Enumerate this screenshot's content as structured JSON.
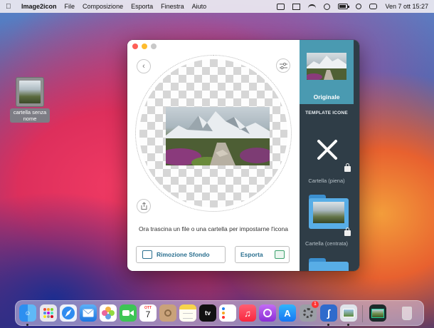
{
  "menubar": {
    "app_name": "Image2icon",
    "items": [
      "File",
      "Composizione",
      "Esporta",
      "Finestra",
      "Aiuto"
    ],
    "clock": "Ven 7 ott  15:27",
    "status_icons": [
      "screen-mirroring-icon",
      "display-icon",
      "wifi-icon",
      "user-icon",
      "battery-icon",
      "search-icon",
      "control-center-icon"
    ]
  },
  "desktop": {
    "folder_label": "cartella senza nome"
  },
  "window": {
    "instruction": "Ora trascina un file o una cartella per impostarne l'icona",
    "remove_bg_label": "Rimozione Sfondo",
    "export_label": "Esporta"
  },
  "sidebar": {
    "original_label": "Originale",
    "section_header": "TEMPLATE ICONE",
    "templates": [
      {
        "label": "Cartella (piena)",
        "locked": true
      },
      {
        "label": "Cartella (centrata)",
        "locked": true
      },
      {
        "label": "",
        "locked": false
      }
    ]
  },
  "dock": {
    "apps": [
      "Finder",
      "Launchpad",
      "Safari",
      "Mail",
      "Foto",
      "FaceTime",
      "Calendario",
      "Contatti",
      "Note",
      "TV",
      "Promemoria",
      "Musica",
      "Podcast",
      "App Store",
      "Impostazioni di Sistema",
      "Image2icon",
      "Anteprima",
      "Image2icon Preview",
      "Cestino"
    ],
    "calendar_day": "7",
    "calendar_month": "OTT",
    "tv_label": "tv",
    "settings_badge": "1"
  },
  "colors": {
    "accent": "#2a6f8f",
    "sidebar_bg": "#2f3d47",
    "sidebar_selected": "#4a9ab1",
    "folder_blue": "#58ade6"
  }
}
